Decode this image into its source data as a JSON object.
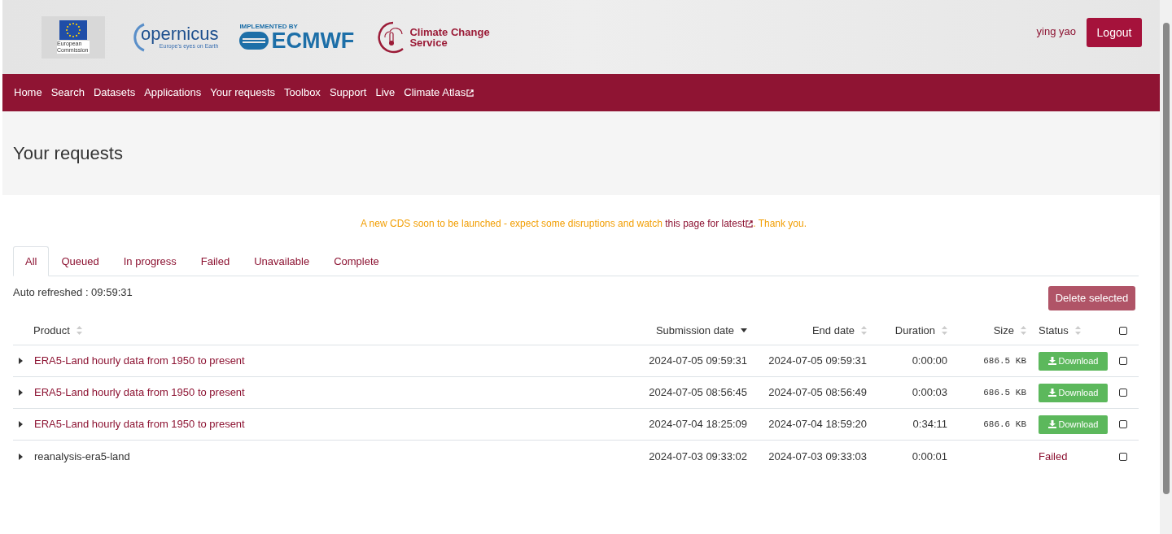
{
  "header": {
    "eu_logo": {
      "caption": "European Commission"
    },
    "copernicus_logo": {
      "name": "opernicus",
      "tagline": "Europe's eyes on Earth"
    },
    "ecmwf_logo": {
      "overline": "IMPLEMENTED BY",
      "name": "ECMWF"
    },
    "c3s_logo": {
      "name": "Climate Change Service"
    },
    "user": "ying yao",
    "logout": "Logout"
  },
  "nav": [
    {
      "label": "Home",
      "external": false
    },
    {
      "label": "Search",
      "external": false
    },
    {
      "label": "Datasets",
      "external": false
    },
    {
      "label": "Applications",
      "external": false
    },
    {
      "label": "Your requests",
      "external": false
    },
    {
      "label": "Toolbox",
      "external": false
    },
    {
      "label": "Support",
      "external": false
    },
    {
      "label": "Live",
      "external": false
    },
    {
      "label": "Climate Atlas",
      "external": true
    }
  ],
  "page_title": "Your requests",
  "notice": {
    "before": "A new CDS soon to be launched - expect some disruptions and watch ",
    "link": "this page for latest",
    "after": ". Thank you."
  },
  "tabs": [
    {
      "label": "All",
      "selected": true
    },
    {
      "label": "Queued",
      "selected": false
    },
    {
      "label": "In progress",
      "selected": false
    },
    {
      "label": "Failed",
      "selected": false
    },
    {
      "label": "Unavailable",
      "selected": false
    },
    {
      "label": "Complete",
      "selected": false
    }
  ],
  "auto_refreshed": "Auto refreshed : 09:59:31",
  "delete_selected": "Delete selected",
  "table": {
    "columns": [
      {
        "label": "Product",
        "sorted": false
      },
      {
        "label": "Submission date",
        "sorted": true
      },
      {
        "label": "End date",
        "sorted": false
      },
      {
        "label": "Duration",
        "sorted": false
      },
      {
        "label": "Size",
        "sorted": false
      },
      {
        "label": "Status",
        "sorted": false
      }
    ],
    "select_all": {
      "checked": false
    },
    "rows": [
      {
        "product": "ERA5-Land hourly data from 1950 to present",
        "kind": "link",
        "submission": "2024-07-05 09:59:31",
        "end": "2024-07-05 09:59:31",
        "duration": "0:00:00",
        "size": "686.5 KB",
        "status": {
          "kind": "download",
          "label": "Download"
        },
        "checked": false
      },
      {
        "product": "ERA5-Land hourly data from 1950 to present",
        "kind": "link",
        "submission": "2024-07-05 08:56:45",
        "end": "2024-07-05 08:56:49",
        "duration": "0:00:03",
        "size": "686.5 KB",
        "status": {
          "kind": "download",
          "label": "Download"
        },
        "checked": false
      },
      {
        "product": "ERA5-Land hourly data from 1950 to present",
        "kind": "link",
        "submission": "2024-07-04 18:25:09",
        "end": "2024-07-04 18:59:20",
        "duration": "0:34:11",
        "size": "686.6 KB",
        "status": {
          "kind": "download",
          "label": "Download"
        },
        "checked": false
      },
      {
        "product": "reanalysis-era5-land",
        "kind": "plain",
        "submission": "2024-07-03 09:33:02",
        "end": "2024-07-03 09:33:03",
        "duration": "0:00:01",
        "status": {
          "kind": "failed",
          "label": "Failed"
        },
        "checked": false
      }
    ]
  }
}
